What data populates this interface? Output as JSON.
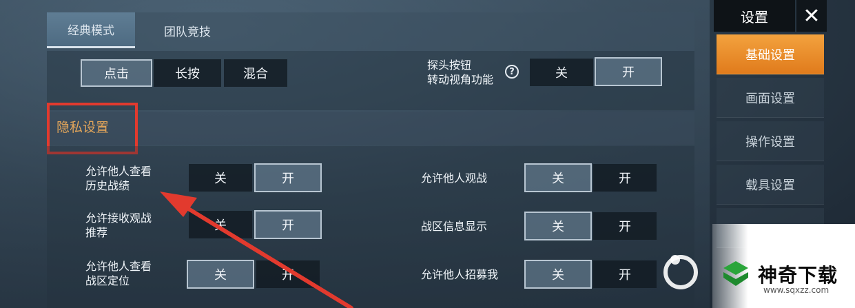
{
  "tabs": [
    {
      "label": "经典模式",
      "active": true
    },
    {
      "label": "团队竞技",
      "active": false
    }
  ],
  "top_row": {
    "press_options": [
      "点击",
      "长按",
      "混合"
    ],
    "press_selected": "点击",
    "peek_label_line1": "探头按钮",
    "peek_label_line2": "转动视角功能",
    "help_icon": "?",
    "peek_off": "关",
    "peek_on": "开",
    "peek_state": "开"
  },
  "privacy": {
    "title": "隐私设置",
    "rows": [
      {
        "line1": "允许他人查看",
        "line2": "历史战绩",
        "off": "关",
        "on": "开",
        "state": "开"
      },
      {
        "line1": "允许接收观战",
        "line2": "推荐",
        "off": "关",
        "on": "开",
        "state": "开"
      },
      {
        "line1": "允许他人查看",
        "line2": "战区定位",
        "off": "关",
        "on": "开",
        "state": "关"
      },
      {
        "line1": "允许他人观战",
        "line2": "",
        "off": "关",
        "on": "开",
        "state": "关"
      },
      {
        "line1": "战区信息显示",
        "line2": "",
        "off": "关",
        "on": "开",
        "state": "关"
      },
      {
        "line1": "允许他人招募我",
        "line2": "",
        "off": "关",
        "on": "开",
        "state": "关"
      }
    ]
  },
  "sidebar": {
    "title": "设置",
    "close_glyph": "✕",
    "items": [
      {
        "label": "基础设置",
        "active": true
      },
      {
        "label": "画面设置",
        "active": false
      },
      {
        "label": "操作设置",
        "active": false
      },
      {
        "label": "载具设置",
        "active": false
      }
    ]
  },
  "watermark": {
    "brand": "神奇下载",
    "url": "www.sqxzz.com"
  },
  "colors": {
    "accent_orange": "#e8881f",
    "highlight_red": "#e23a2e",
    "section_title": "#e2a55a"
  }
}
